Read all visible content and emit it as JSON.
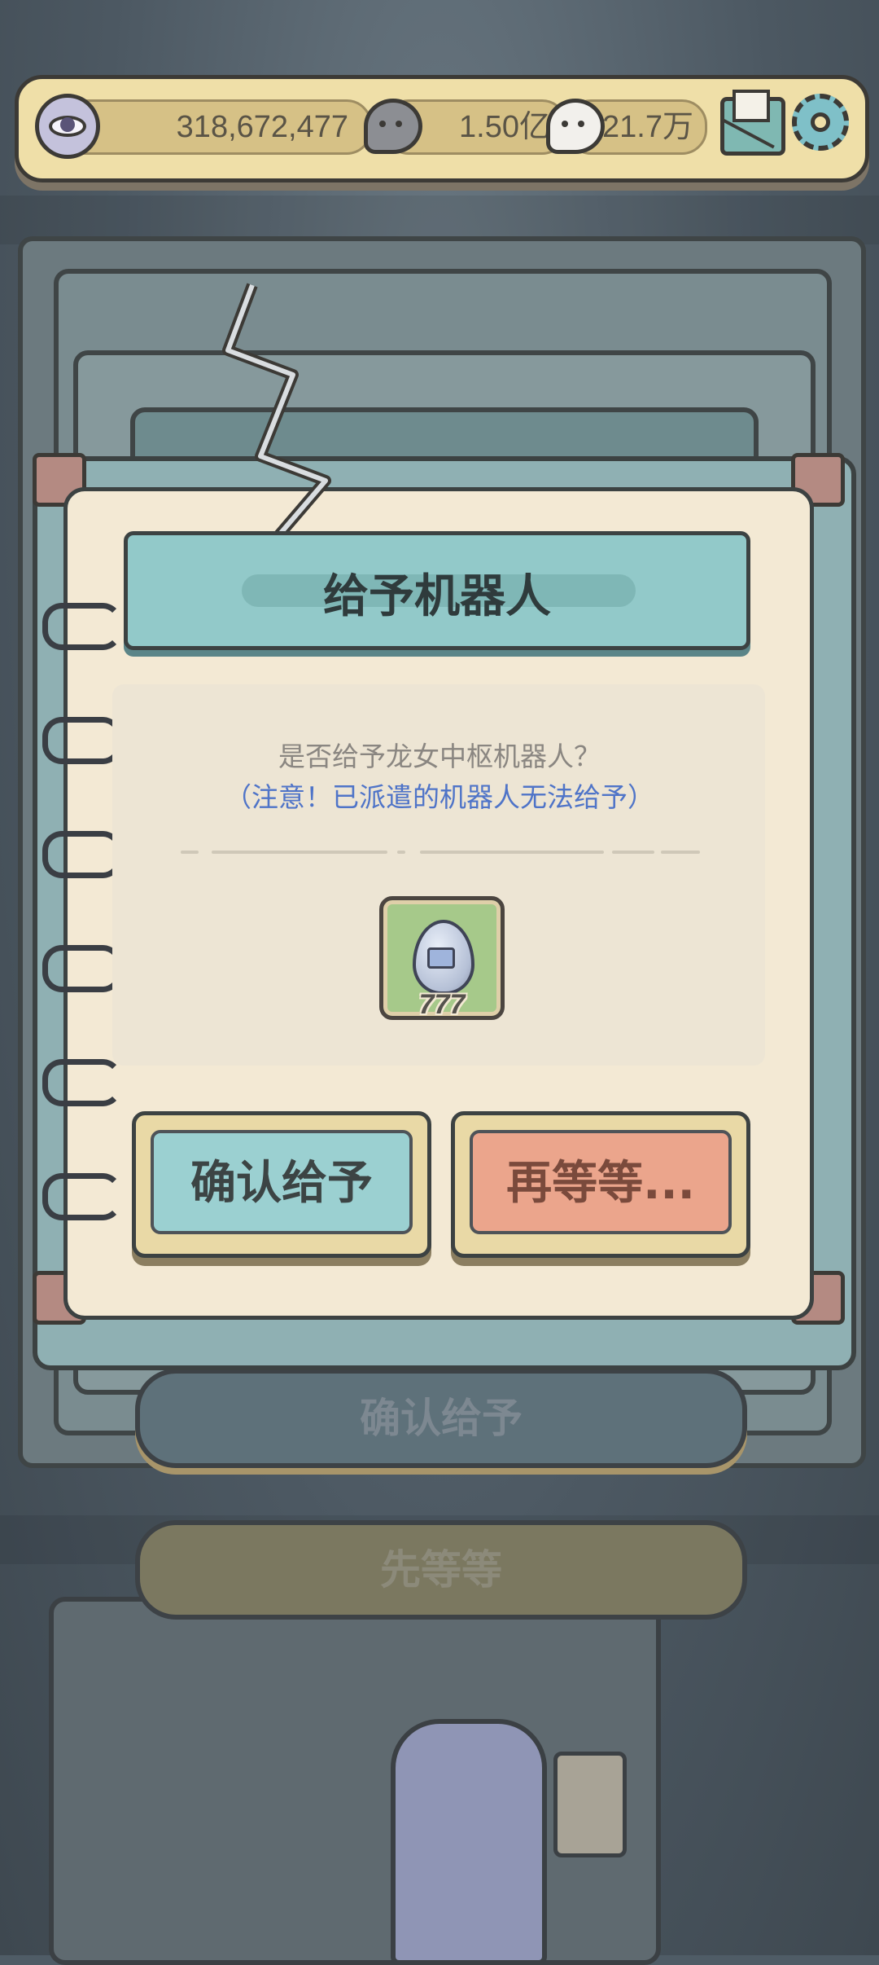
{
  "top_bar": {
    "eye_count": "318,672,477",
    "gray_bubble_count": "1.50亿",
    "white_bubble_count": "21.7万",
    "icons": [
      "eye-icon",
      "gray-speech-bubble-icon",
      "white-speech-bubble-icon",
      "mail-icon",
      "gear-icon"
    ]
  },
  "background": {
    "confirm_label": "确认给予",
    "wait_label": "先等等"
  },
  "dialog": {
    "title": "给予机器人",
    "question": "是否给予龙女中枢机器人？",
    "warning": "（注意！已派遣的机器人无法给予）",
    "item": {
      "icon": "robot-egg-icon",
      "count": "777"
    },
    "confirm_label": "确认给予",
    "cancel_label": "再等等..."
  },
  "colors": {
    "confirm_button": "#9bd0d1",
    "cancel_button": "#eba58c",
    "warning_text": "#4f74c8",
    "title_bar": "#92c9c9",
    "paper": "#f3e9d4"
  }
}
